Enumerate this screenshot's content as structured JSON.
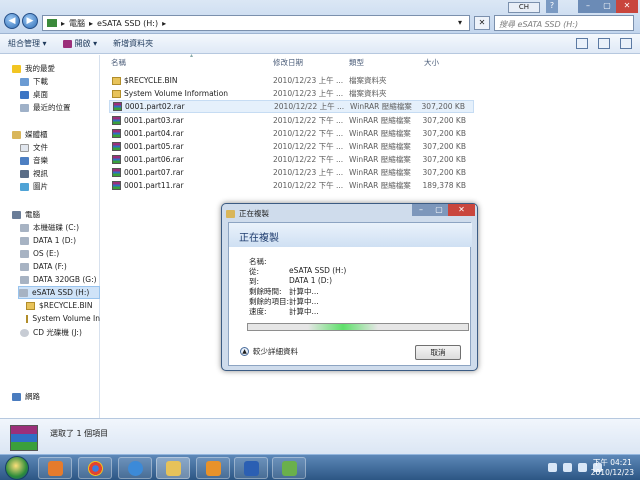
{
  "address": {
    "crumbs": [
      "電腦",
      "eSATA SSD (H:)"
    ],
    "search_placeholder": "搜尋 eSATA SSD (H:)",
    "lang": "CH"
  },
  "toolbar": {
    "organize": "組合管理 ▾",
    "open": "開啟 ▾",
    "new_folder": "新增資料夾"
  },
  "nav": {
    "favorites": "我的最愛",
    "downloads": "下載",
    "desktop": "桌面",
    "recent": "最近的位置",
    "libraries": "媒體櫃",
    "documents": "文件",
    "music": "音樂",
    "videos": "視訊",
    "pictures": "圖片",
    "computer": "電腦",
    "drives": [
      "本機磁碟 (C:)",
      "DATA 1 (D:)",
      "OS (E:)",
      "DATA (F:)",
      "DATA 320GB (G:)",
      "eSATA SSD (H:)"
    ],
    "subfolders": [
      "$RECYCLE.BIN",
      "System Volume In"
    ],
    "cd": "CD 光碟機 (J:)",
    "network": "網路"
  },
  "columns": {
    "name": "名稱",
    "date": "修改日期",
    "type": "類型",
    "size": "大小"
  },
  "files": [
    {
      "name": "$RECYCLE.BIN",
      "date": "2010/12/23 上午 ...",
      "type": "檔案資料夾",
      "size": "",
      "icon": "folder"
    },
    {
      "name": "System Volume Information",
      "date": "2010/12/23 上午 ...",
      "type": "檔案資料夾",
      "size": "",
      "icon": "folder"
    },
    {
      "name": "0001.part02.rar",
      "date": "2010/12/22 上午 ...",
      "type": "WinRAR 壓縮檔案",
      "size": "307,200 KB",
      "icon": "rar"
    },
    {
      "name": "0001.part03.rar",
      "date": "2010/12/22 下午 ...",
      "type": "WinRAR 壓縮檔案",
      "size": "307,200 KB",
      "icon": "rar"
    },
    {
      "name": "0001.part04.rar",
      "date": "2010/12/22 下午 ...",
      "type": "WinRAR 壓縮檔案",
      "size": "307,200 KB",
      "icon": "rar"
    },
    {
      "name": "0001.part05.rar",
      "date": "2010/12/22 下午 ...",
      "type": "WinRAR 壓縮檔案",
      "size": "307,200 KB",
      "icon": "rar"
    },
    {
      "name": "0001.part06.rar",
      "date": "2010/12/22 下午 ...",
      "type": "WinRAR 壓縮檔案",
      "size": "307,200 KB",
      "icon": "rar"
    },
    {
      "name": "0001.part07.rar",
      "date": "2010/12/23 上午 ...",
      "type": "WinRAR 壓縮檔案",
      "size": "307,200 KB",
      "icon": "rar"
    },
    {
      "name": "0001.part11.rar",
      "date": "2010/12/22 下午 ...",
      "type": "WinRAR 壓縮檔案",
      "size": "189,378 KB",
      "icon": "rar"
    }
  ],
  "status": {
    "text": "選取了 1 個項目"
  },
  "dialog": {
    "title": "正在複製",
    "heading": "正在複製",
    "name_label": "名稱:",
    "from_label": "從:",
    "from_value": "eSATA SSD (H:)",
    "to_label": "到:",
    "to_value": "DATA 1 (D:)",
    "time_label": "剩餘時間:",
    "time_value": "計算中...",
    "items_label": "剩餘的項目:",
    "items_value": "計算中...",
    "speed_label": "速度:",
    "speed_value": "計算中...",
    "less_details": "較少詳細資料",
    "cancel": "取消"
  },
  "taskbar": {
    "time": "下午 04:21",
    "date": "2010/12/23"
  }
}
